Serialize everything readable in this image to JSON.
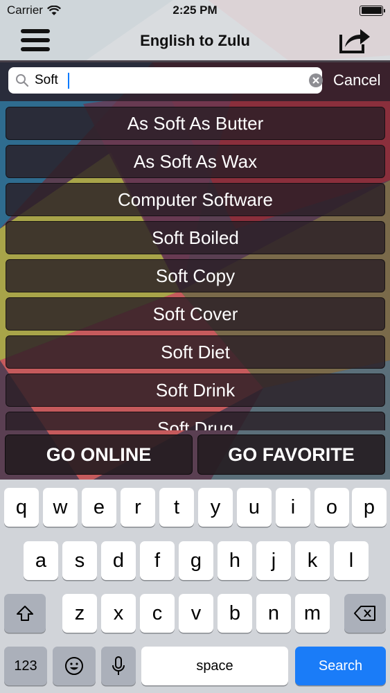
{
  "status": {
    "carrier": "Carrier",
    "time": "2:25 PM"
  },
  "nav": {
    "title": "English to Zulu",
    "menu_icon": "hamburger-icon",
    "share_icon": "share-icon"
  },
  "search": {
    "value": "Soft",
    "placeholder": "",
    "cancel_label": "Cancel"
  },
  "results": [
    "As Soft As Butter",
    "As Soft As Wax",
    "Computer Software",
    "Soft Boiled",
    "Soft Copy",
    "Soft Cover",
    "Soft Diet",
    "Soft Drink",
    "Soft Drug"
  ],
  "buttons": {
    "go_online": "GO ONLINE",
    "go_favorite": "GO FAVORITE"
  },
  "keyboard": {
    "row1": [
      "q",
      "w",
      "e",
      "r",
      "t",
      "y",
      "u",
      "i",
      "o",
      "p"
    ],
    "row2": [
      "a",
      "s",
      "d",
      "f",
      "g",
      "h",
      "j",
      "k",
      "l"
    ],
    "row3": [
      "z",
      "x",
      "c",
      "v",
      "b",
      "n",
      "m"
    ],
    "numbers_label": "123",
    "space_label": "space",
    "search_label": "Search"
  },
  "colors": {
    "accent": "#1a7cf8",
    "list_bg": "#2a1e26",
    "keyboard_bg": "#d1d4d9"
  }
}
